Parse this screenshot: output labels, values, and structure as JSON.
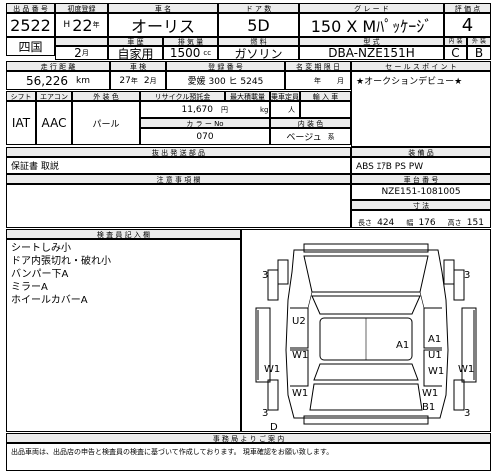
{
  "header_labels": {
    "lot_no": "出 品 番 号",
    "first_reg": "初度登録",
    "car_name": "車 名",
    "doors": "ド ア 数",
    "grade": "グ レ ー ド",
    "score": "評 価 点",
    "usage": "車 歴",
    "displacement": "排 気 量",
    "fuel": "燃 料",
    "model": "型 式",
    "interior": "内 装",
    "exterior": "外 装",
    "mileage": "走 行 距 離",
    "inspection": "車 検",
    "plate": "登 録 番 号",
    "owner_name": "名 変 期 限 日",
    "sales_point": "セ ー ル ス ポ イ ン ト",
    "shift": "シフト",
    "aircon": "エアコン",
    "appearance": "外 装 色",
    "recycle": "リサイクル預託金",
    "max_capacity": "最大積載量",
    "rider_capacity": "乗車定員",
    "import": "輸 入 車",
    "color": "カ ラ ー No",
    "interior_color": "内 装 色",
    "notes_head": "抜 出 発 送 部 品",
    "attention_head": "注 意 事 項 欄",
    "equipment_head": "装 備 品",
    "chassis_head": "車 台 番 号",
    "dims_head": "寸 法",
    "inspector_head": "検 査 員 記 入 欄",
    "footer_head": "事 務 局 よ り ご 案 内"
  },
  "vehicle": {
    "lot_no": "2522",
    "era": "H",
    "year": "22",
    "year_unit": "年",
    "month": "2",
    "month_unit": "月",
    "name": "オーリス",
    "doors": "5D",
    "grade": "150 X Mﾊﾟｯｹｰｼﾞ",
    "score": "4",
    "region": "四国",
    "usage": "自家用",
    "displacement": "1500",
    "displacement_unit": "cc",
    "fuel": "ガソリン",
    "model": "DBA-NZE151H",
    "interior_grade": "C",
    "exterior_grade": "B",
    "mileage": "56,226",
    "mileage_unit": "km",
    "inspection_year": "27",
    "inspection_year_unit": "年",
    "inspection_month": "2",
    "inspection_month_unit": "月",
    "plate": "愛媛 300 ヒ 5245",
    "owner_year_unit": "年",
    "owner_month_unit": "月",
    "shift": "IAT",
    "aircon": "AAC",
    "body_color": "パール",
    "recycle_fee": "11,670",
    "recycle_unit": "円",
    "max_load_unit": "kg",
    "riders_unit": "人",
    "color_no": "070",
    "interior_color": "ベージュ",
    "interior_color_suffix": "系",
    "sales_point": "★オークションデビュー★",
    "notes": "保証書 取説",
    "equipment": "ABS ｴｱB PS PW",
    "chassis": "NZE151-1081005",
    "dims": {
      "length_label": "長さ",
      "length": "424",
      "width_label": "幅",
      "width": "176",
      "height_label": "高さ",
      "height": "151",
      "unit": "cm"
    }
  },
  "inspector_notes": [
    "シートしみ小",
    "ドア内張切れ・破れ小",
    "バンパー下A",
    "ミラーA",
    "ホイールカバーA"
  ],
  "damage_marks": {
    "front_left": "3",
    "front_right": "3",
    "rear_left": "3",
    "rear_right": "3",
    "hood": "U2",
    "left_door_front": "W1",
    "left_panel": "W1",
    "right_a1_top": "A1",
    "right_a1_mid": "A1",
    "right_u1": "U1",
    "right_door": "W1",
    "right_panel": "W1",
    "rear_right_w1": "W1",
    "rear_right_b1": "B1",
    "bottom_bumper": "D",
    "left_lower_w1": "W1"
  },
  "footer_text": "出品車両は、出品店の申告と検査員の検査に基づいて作成しております。 現車確認をお願い致します。"
}
